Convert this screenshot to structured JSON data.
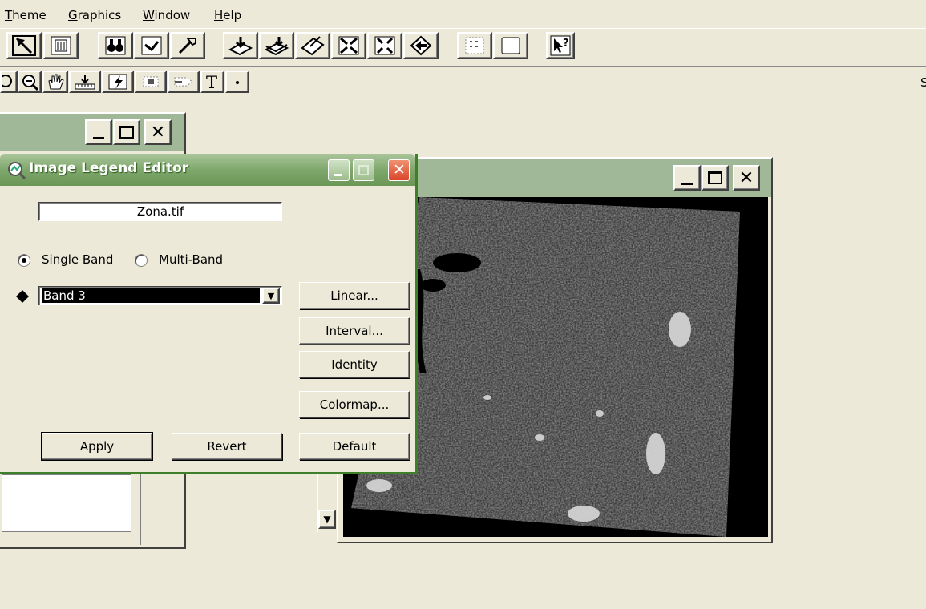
{
  "menu": [
    "Theme",
    "Graphics",
    "Window",
    "Help"
  ],
  "toolbar_edge_text": "S",
  "icons": {
    "row1": [
      "select-icon",
      "table-icon",
      "binoculars-icon",
      "identify-icon",
      "hammer-icon",
      "add-theme-icon",
      "add-layer-icon",
      "editor-icon",
      "zoom-in-fixed-icon",
      "zoom-out-fixed-icon",
      "back-icon",
      "select-all-icon",
      "clear-icon",
      "help-cursor-icon"
    ],
    "row2": [
      "zoom-in-icon",
      "zoom-out-icon",
      "pan-icon",
      "measure-icon",
      "hotlink-icon",
      "label-icon",
      "text-label-icon",
      "text-icon",
      "point-icon"
    ]
  },
  "legend_editor": {
    "title": "Image Legend Editor",
    "filename": "Zona.tif",
    "mode_single": "Single Band",
    "mode_multi": "Multi-Band",
    "mode_selected": "Single Band",
    "band_selected": "Band 3",
    "buttons": {
      "linear": "Linear...",
      "interval": "Interval...",
      "identity": "Identity",
      "colormap": "Colormap...",
      "apply": "Apply",
      "revert": "Revert",
      "default": "Default"
    }
  },
  "colors": {
    "desktop": "#ece9d8",
    "xp_title": "#7fa86c",
    "view_title": "#a0b898",
    "image_background": "#000000",
    "selection": "#000000"
  }
}
